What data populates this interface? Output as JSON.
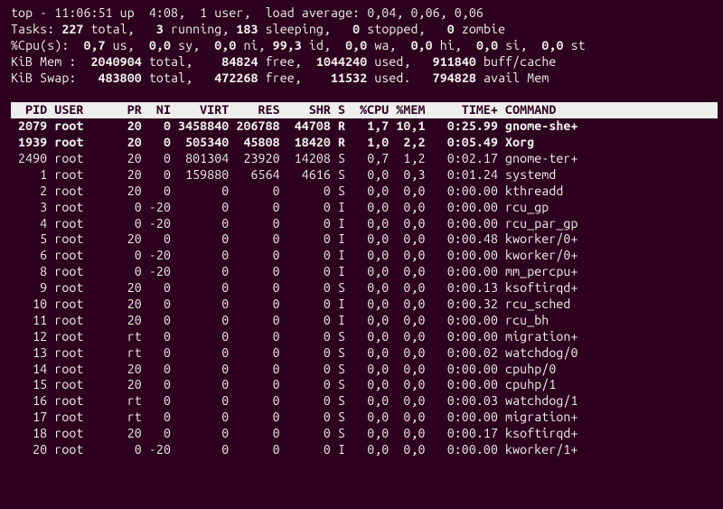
{
  "summary": {
    "line1_plain": "top - 11:06:51 up  4:08,  1 user,  load average: 0,04, 0,06, 0,06",
    "line2_a": "Tasks: ",
    "line2_b": "227 ",
    "line2_c": "total,   ",
    "line2_d": "3 ",
    "line2_e": "running, ",
    "line2_f": "183 ",
    "line2_g": "sleeping,   ",
    "line2_h": "0 ",
    "line2_i": "stopped,   ",
    "line2_j": "0 ",
    "line2_k": "zombie",
    "line3_a": "%Cpu(s):  ",
    "line3_b": "0,7 ",
    "line3_c": "us,  ",
    "line3_d": "0,0 ",
    "line3_e": "sy,  ",
    "line3_f": "0,0 ",
    "line3_g": "ni, ",
    "line3_h": "99,3 ",
    "line3_i": "id,  ",
    "line3_j": "0,0 ",
    "line3_k": "wa,  ",
    "line3_l": "0,0 ",
    "line3_m": "hi,  ",
    "line3_n": "0,0 ",
    "line3_o": "si,  ",
    "line3_p": "0,0 ",
    "line3_q": "st",
    "line4_a": "KiB Mem : ",
    "line4_b": " 2040904 ",
    "line4_c": "total,   ",
    "line4_d": " 84824 ",
    "line4_e": "free,  ",
    "line4_f": "1044240 ",
    "line4_g": "used,   ",
    "line4_h": "911840 ",
    "line4_i": "buff/cache",
    "line5_a": "KiB Swap:   ",
    "line5_b": "483800 ",
    "line5_c": "total,   ",
    "line5_d": "472268 ",
    "line5_e": "free,    ",
    "line5_f": "11532 ",
    "line5_g": "used.   ",
    "line5_h": "794828 ",
    "line5_i": "avail Mem "
  },
  "header_line": "  PID USER      PR  NI    VIRT    RES    SHR S  %CPU %MEM     TIME+ COMMAND   ",
  "rows": [
    {
      "bold": true,
      "pid": "2079",
      "user": "root",
      "pr": "20",
      "ni": "0",
      "virt": "3458840",
      "res": "206788",
      "shr": "44708",
      "s": "R",
      "cpu": "1,7",
      "mem": "10,1",
      "time": "0:25.99",
      "cmd": "gnome-she+"
    },
    {
      "bold": true,
      "pid": "1939",
      "user": "root",
      "pr": "20",
      "ni": "0",
      "virt": "505340",
      "res": "45808",
      "shr": "18420",
      "s": "R",
      "cpu": "1,0",
      "mem": "2,2",
      "time": "0:05.49",
      "cmd": "Xorg"
    },
    {
      "bold": false,
      "pid": "2490",
      "user": "root",
      "pr": "20",
      "ni": "0",
      "virt": "801304",
      "res": "23920",
      "shr": "14208",
      "s": "S",
      "cpu": "0,7",
      "mem": "1,2",
      "time": "0:02.17",
      "cmd": "gnome-ter+"
    },
    {
      "bold": false,
      "pid": "1",
      "user": "root",
      "pr": "20",
      "ni": "0",
      "virt": "159880",
      "res": "6564",
      "shr": "4616",
      "s": "S",
      "cpu": "0,0",
      "mem": "0,3",
      "time": "0:01.24",
      "cmd": "systemd"
    },
    {
      "bold": false,
      "pid": "2",
      "user": "root",
      "pr": "20",
      "ni": "0",
      "virt": "0",
      "res": "0",
      "shr": "0",
      "s": "S",
      "cpu": "0,0",
      "mem": "0,0",
      "time": "0:00.00",
      "cmd": "kthreadd"
    },
    {
      "bold": false,
      "pid": "3",
      "user": "root",
      "pr": "0",
      "ni": "-20",
      "virt": "0",
      "res": "0",
      "shr": "0",
      "s": "I",
      "cpu": "0,0",
      "mem": "0,0",
      "time": "0:00.00",
      "cmd": "rcu_gp"
    },
    {
      "bold": false,
      "pid": "4",
      "user": "root",
      "pr": "0",
      "ni": "-20",
      "virt": "0",
      "res": "0",
      "shr": "0",
      "s": "I",
      "cpu": "0,0",
      "mem": "0,0",
      "time": "0:00.00",
      "cmd": "rcu_par_gp"
    },
    {
      "bold": false,
      "pid": "5",
      "user": "root",
      "pr": "20",
      "ni": "0",
      "virt": "0",
      "res": "0",
      "shr": "0",
      "s": "I",
      "cpu": "0,0",
      "mem": "0,0",
      "time": "0:00.48",
      "cmd": "kworker/0+"
    },
    {
      "bold": false,
      "pid": "6",
      "user": "root",
      "pr": "0",
      "ni": "-20",
      "virt": "0",
      "res": "0",
      "shr": "0",
      "s": "I",
      "cpu": "0,0",
      "mem": "0,0",
      "time": "0:00.00",
      "cmd": "kworker/0+"
    },
    {
      "bold": false,
      "pid": "8",
      "user": "root",
      "pr": "0",
      "ni": "-20",
      "virt": "0",
      "res": "0",
      "shr": "0",
      "s": "I",
      "cpu": "0,0",
      "mem": "0,0",
      "time": "0:00.00",
      "cmd": "mm_percpu+"
    },
    {
      "bold": false,
      "pid": "9",
      "user": "root",
      "pr": "20",
      "ni": "0",
      "virt": "0",
      "res": "0",
      "shr": "0",
      "s": "S",
      "cpu": "0,0",
      "mem": "0,0",
      "time": "0:00.13",
      "cmd": "ksoftirqd+"
    },
    {
      "bold": false,
      "pid": "10",
      "user": "root",
      "pr": "20",
      "ni": "0",
      "virt": "0",
      "res": "0",
      "shr": "0",
      "s": "I",
      "cpu": "0,0",
      "mem": "0,0",
      "time": "0:00.32",
      "cmd": "rcu_sched"
    },
    {
      "bold": false,
      "pid": "11",
      "user": "root",
      "pr": "20",
      "ni": "0",
      "virt": "0",
      "res": "0",
      "shr": "0",
      "s": "I",
      "cpu": "0,0",
      "mem": "0,0",
      "time": "0:00.00",
      "cmd": "rcu_bh"
    },
    {
      "bold": false,
      "pid": "12",
      "user": "root",
      "pr": "rt",
      "ni": "0",
      "virt": "0",
      "res": "0",
      "shr": "0",
      "s": "S",
      "cpu": "0,0",
      "mem": "0,0",
      "time": "0:00.00",
      "cmd": "migration+"
    },
    {
      "bold": false,
      "pid": "13",
      "user": "root",
      "pr": "rt",
      "ni": "0",
      "virt": "0",
      "res": "0",
      "shr": "0",
      "s": "S",
      "cpu": "0,0",
      "mem": "0,0",
      "time": "0:00.02",
      "cmd": "watchdog/0"
    },
    {
      "bold": false,
      "pid": "14",
      "user": "root",
      "pr": "20",
      "ni": "0",
      "virt": "0",
      "res": "0",
      "shr": "0",
      "s": "S",
      "cpu": "0,0",
      "mem": "0,0",
      "time": "0:00.00",
      "cmd": "cpuhp/0"
    },
    {
      "bold": false,
      "pid": "15",
      "user": "root",
      "pr": "20",
      "ni": "0",
      "virt": "0",
      "res": "0",
      "shr": "0",
      "s": "S",
      "cpu": "0,0",
      "mem": "0,0",
      "time": "0:00.00",
      "cmd": "cpuhp/1"
    },
    {
      "bold": false,
      "pid": "16",
      "user": "root",
      "pr": "rt",
      "ni": "0",
      "virt": "0",
      "res": "0",
      "shr": "0",
      "s": "S",
      "cpu": "0,0",
      "mem": "0,0",
      "time": "0:00.03",
      "cmd": "watchdog/1"
    },
    {
      "bold": false,
      "pid": "17",
      "user": "root",
      "pr": "rt",
      "ni": "0",
      "virt": "0",
      "res": "0",
      "shr": "0",
      "s": "S",
      "cpu": "0,0",
      "mem": "0,0",
      "time": "0:00.00",
      "cmd": "migration+"
    },
    {
      "bold": false,
      "pid": "18",
      "user": "root",
      "pr": "20",
      "ni": "0",
      "virt": "0",
      "res": "0",
      "shr": "0",
      "s": "S",
      "cpu": "0,0",
      "mem": "0,0",
      "time": "0:00.17",
      "cmd": "ksoftirqd+"
    },
    {
      "bold": false,
      "pid": "20",
      "user": "root",
      "pr": "0",
      "ni": "-20",
      "virt": "0",
      "res": "0",
      "shr": "0",
      "s": "I",
      "cpu": "0,0",
      "mem": "0,0",
      "time": "0:00.00",
      "cmd": "kworker/1+"
    }
  ]
}
